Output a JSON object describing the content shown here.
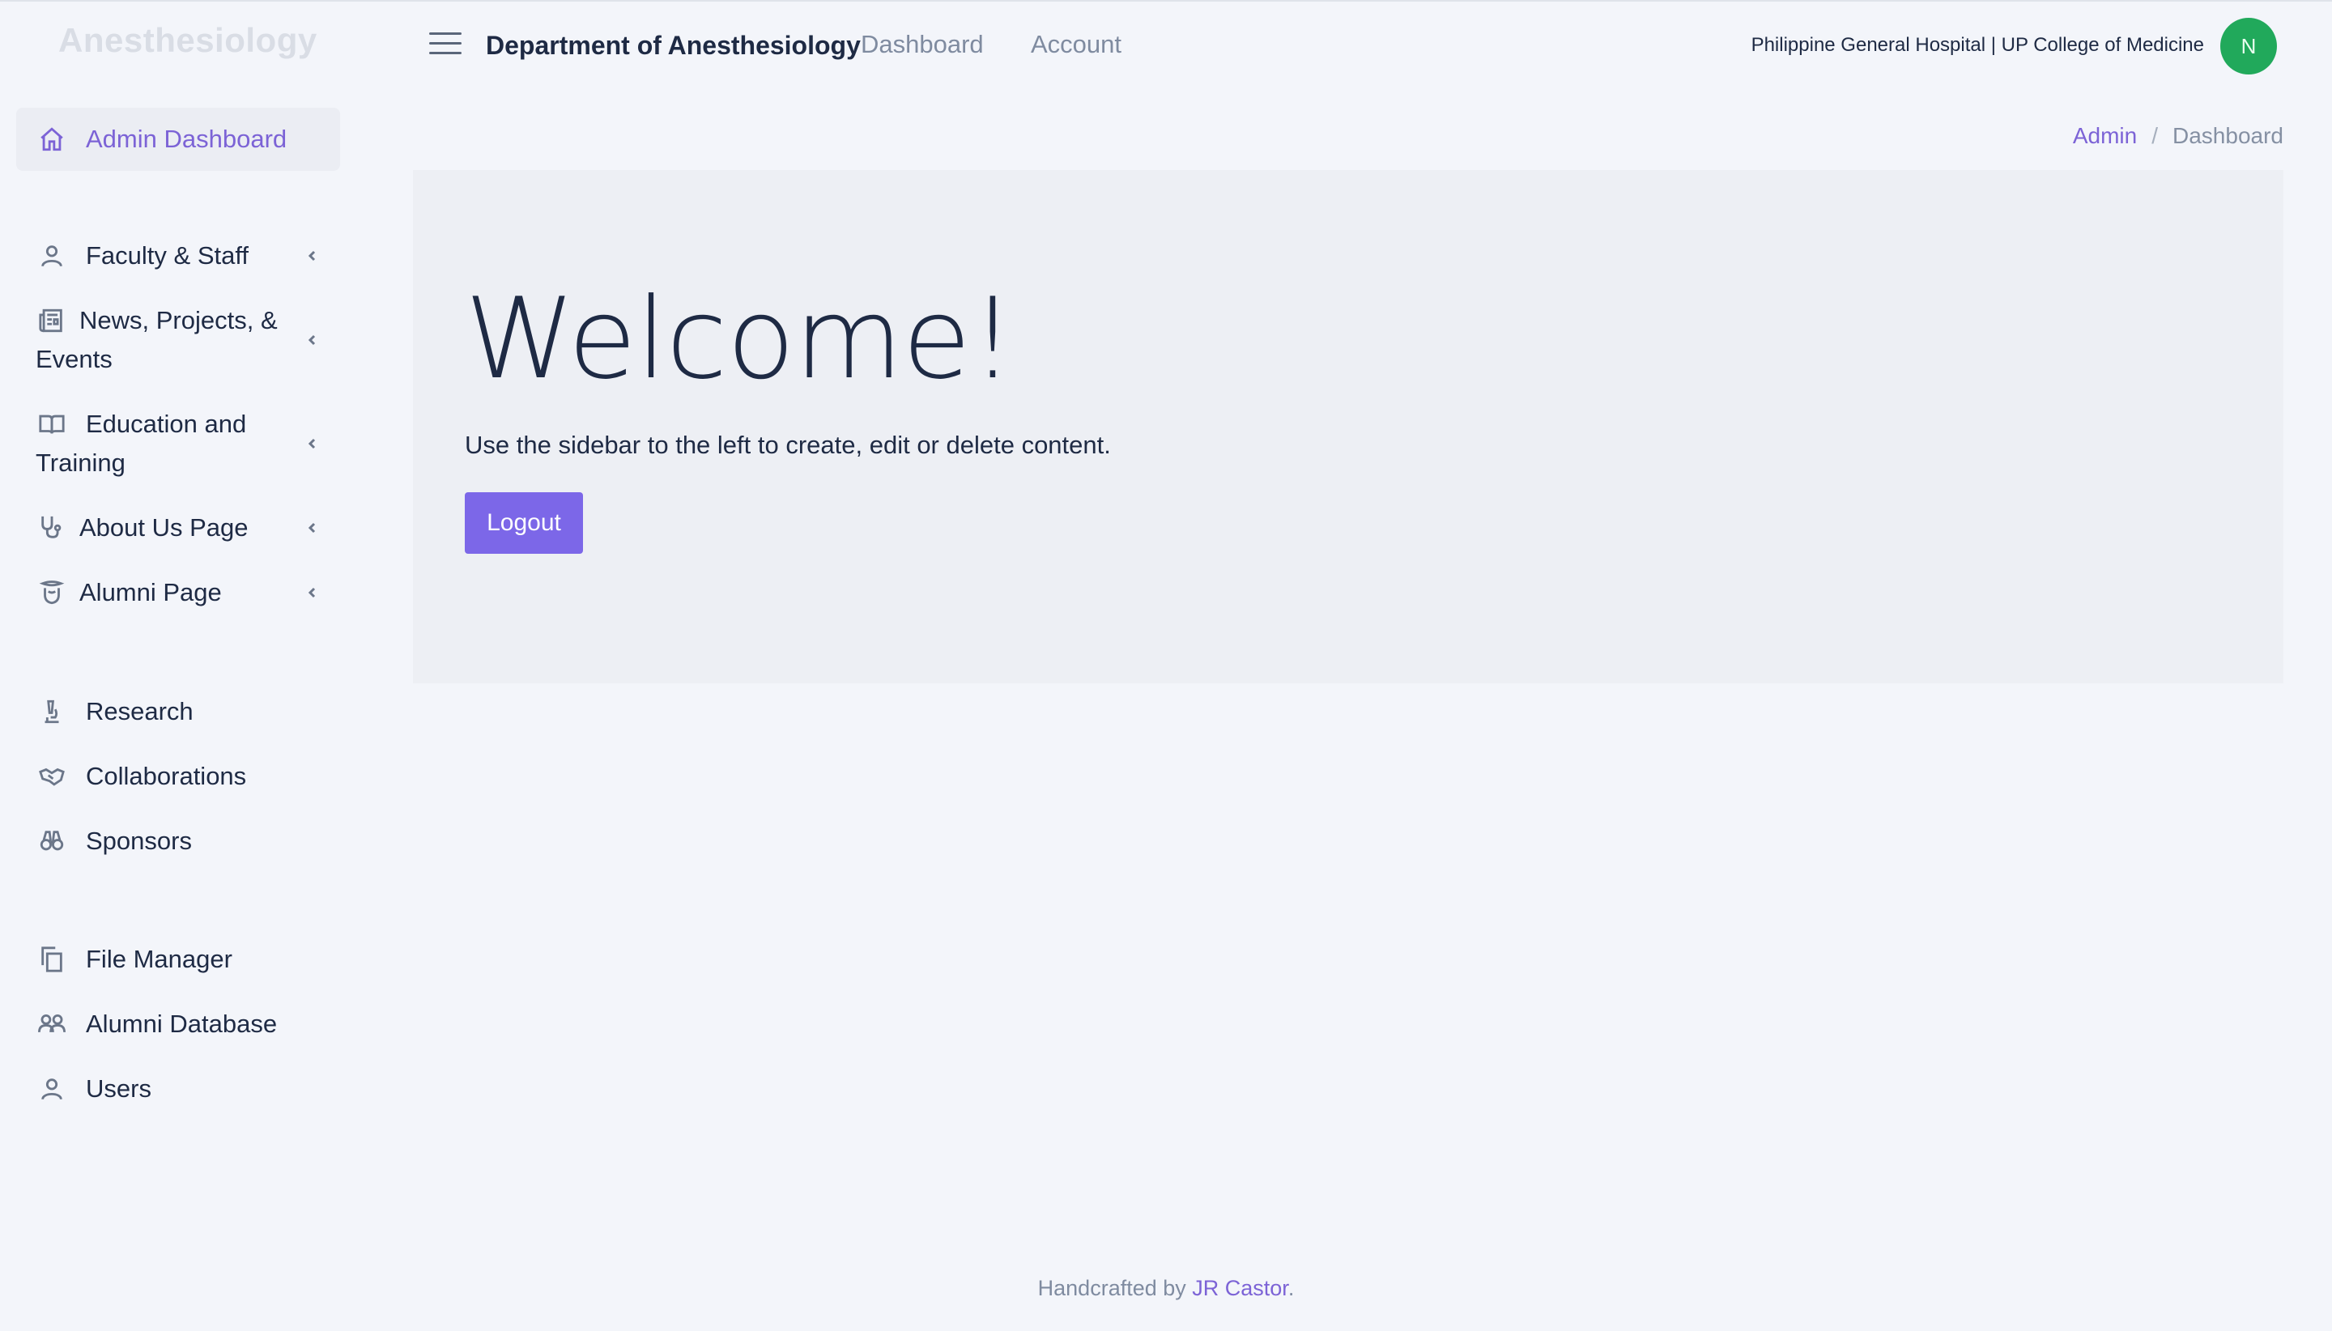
{
  "brand": "Anesthesiology",
  "header": {
    "title": "Department of Anesthesiology",
    "links": [
      "Dashboard",
      "Account"
    ],
    "org": "Philippine General Hospital | UP College of Medicine",
    "avatar_initial": "N"
  },
  "sidebar": {
    "active": "Admin Dashboard",
    "groups": [
      {
        "label": "Faculty & Staff",
        "icon": "user-icon"
      },
      {
        "label": "News, Projects, & Events",
        "icon": "newspaper-icon"
      },
      {
        "label": "Education and Training",
        "icon": "book-open-icon"
      },
      {
        "label": "About Us Page",
        "icon": "stethoscope-icon"
      },
      {
        "label": "Alumni Page",
        "icon": "graduation-icon"
      }
    ],
    "items": [
      {
        "label": "Research",
        "icon": "microscope-icon"
      },
      {
        "label": "Collaborations",
        "icon": "handshake-icon"
      },
      {
        "label": "Sponsors",
        "icon": "binoculars-icon"
      },
      {
        "label": "File Manager",
        "icon": "files-icon"
      },
      {
        "label": "Alumni Database",
        "icon": "users-icon"
      },
      {
        "label": "Users",
        "icon": "user-icon"
      }
    ]
  },
  "breadcrumb": {
    "root": "Admin",
    "separator": "/",
    "current": "Dashboard"
  },
  "main": {
    "heading": "Welcome!",
    "lead": "Use the sidebar to the left to create, edit or delete content.",
    "logout_label": "Logout"
  },
  "footer": {
    "prefix": "Handcrafted by ",
    "author": "JR Castor",
    "suffix": "."
  },
  "colors": {
    "accent": "#7c63d6",
    "button": "#7c67e8",
    "avatar": "#21a95b",
    "background": "#f3f5fa"
  }
}
